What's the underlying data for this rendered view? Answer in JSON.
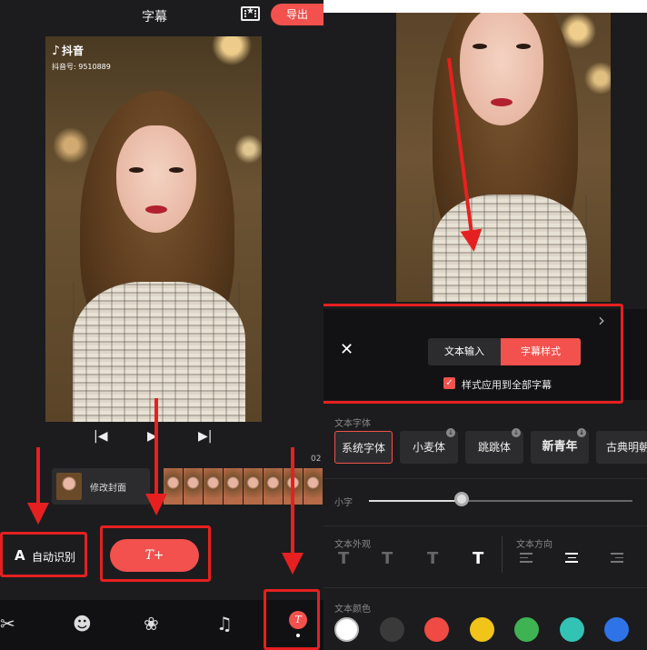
{
  "left": {
    "title": "字幕",
    "export_label": "导出",
    "video": {
      "brand": "抖音",
      "id_text": "抖音号: 9510889"
    },
    "timeline": {
      "time": "02",
      "cover_label": "修改封面"
    },
    "auto_label": "自动识别",
    "add_label": "T+",
    "nav_sub_label": "T"
  },
  "right": {
    "tabs": [
      "文本输入",
      "字幕样式"
    ],
    "apply_all_label": "样式应用到全部字幕",
    "font_section": "文本字体",
    "fonts": [
      "系统字体",
      "小麦体",
      "跳跳体",
      "新青年",
      "古典明朝"
    ],
    "size_label": "小字",
    "size_value": 0.35,
    "appearance_label": "文本外观",
    "direction_label": "文本方向",
    "color_label": "文本颜色",
    "colors": [
      "#ffffff",
      "#3a3a3a",
      "#ef4a43",
      "#f0c419",
      "#3fb353",
      "#33c3b4",
      "#2f73e8"
    ],
    "accent": "#f2514d",
    "annotation_color": "#e62020"
  }
}
